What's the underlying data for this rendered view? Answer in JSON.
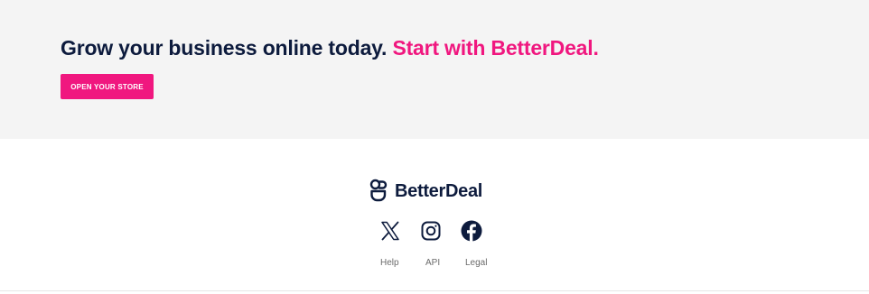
{
  "cta": {
    "heading_main": "Grow your business online today.",
    "heading_accent": "Start with BetterDeal.",
    "button_label": "OPEN YOUR STORE"
  },
  "footer": {
    "brand_name": "BetterDeal",
    "social": [
      {
        "icon": "x-icon",
        "platform": "X"
      },
      {
        "icon": "instagram-icon",
        "platform": "Instagram"
      },
      {
        "icon": "facebook-icon",
        "platform": "Facebook"
      }
    ],
    "links": [
      "Help",
      "API",
      "Legal"
    ]
  },
  "colors": {
    "accent": "#f0177f",
    "navy": "#0d1b3d",
    "band_background": "#f4f4f4",
    "link_text": "#6b6b6b"
  }
}
